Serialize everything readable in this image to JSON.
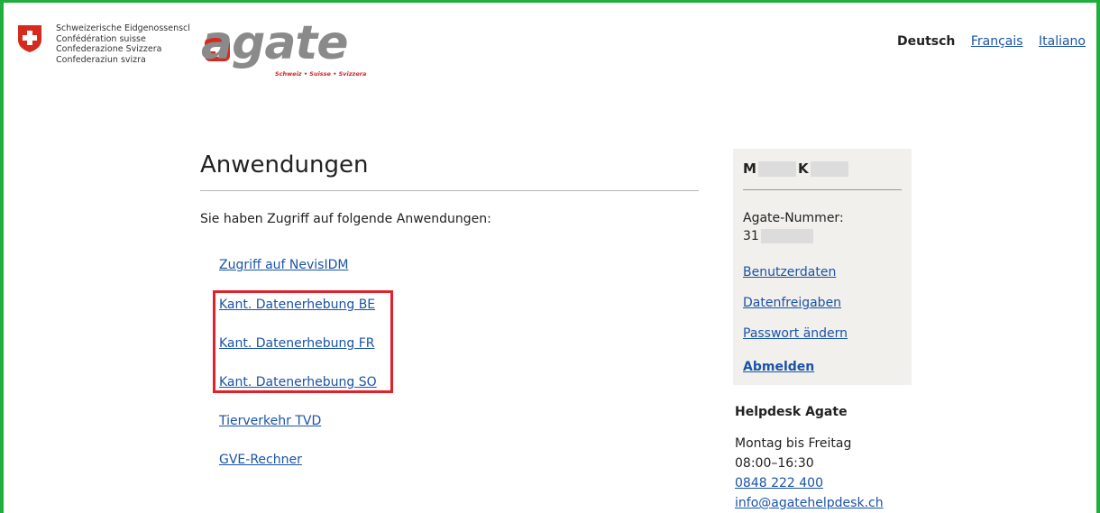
{
  "header": {
    "confederation_lines": [
      "Schweizerische Eidgenossenschaft",
      "Confédération suisse",
      "Confederazione Svizzera",
      "Confederaziun svizra"
    ],
    "logo_word": "agate",
    "logo_tagline": "Schweiz • Suisse • Svizzera",
    "languages": [
      {
        "label": "Deutsch",
        "active": true
      },
      {
        "label": "Français",
        "active": false
      },
      {
        "label": "Italiano",
        "active": false
      }
    ]
  },
  "main": {
    "title": "Anwendungen",
    "intro": "Sie haben Zugriff auf folgende Anwendungen:",
    "applications": [
      "Zugriff auf NevisIDM",
      "Kant. Datenerhebung BE",
      "Kant. Datenerhebung FR",
      "Kant. Datenerhebung SO",
      "Tierverkehr TVD",
      "GVE-Rechner"
    ]
  },
  "user_panel": {
    "initial_first": "M",
    "initial_last": "K",
    "agate_number_label": "Agate-Nummer:",
    "agate_number_prefix": "31",
    "links": [
      "Benutzerdaten",
      "Datenfreigaben",
      "Passwort ändern"
    ],
    "logout": "Abmelden"
  },
  "helpdesk": {
    "title": "Helpdesk Agate",
    "days": "Montag bis Freitag",
    "hours": "08:00–16:30",
    "phone": "0848 222 400",
    "email": "info@agatehelpdesk.ch"
  },
  "colors": {
    "link": "#1a53a8",
    "highlight": "#e0202a",
    "frame": "#1fae3b",
    "panel_bg": "#f2f0ec",
    "swiss_red": "#d52b1e"
  }
}
